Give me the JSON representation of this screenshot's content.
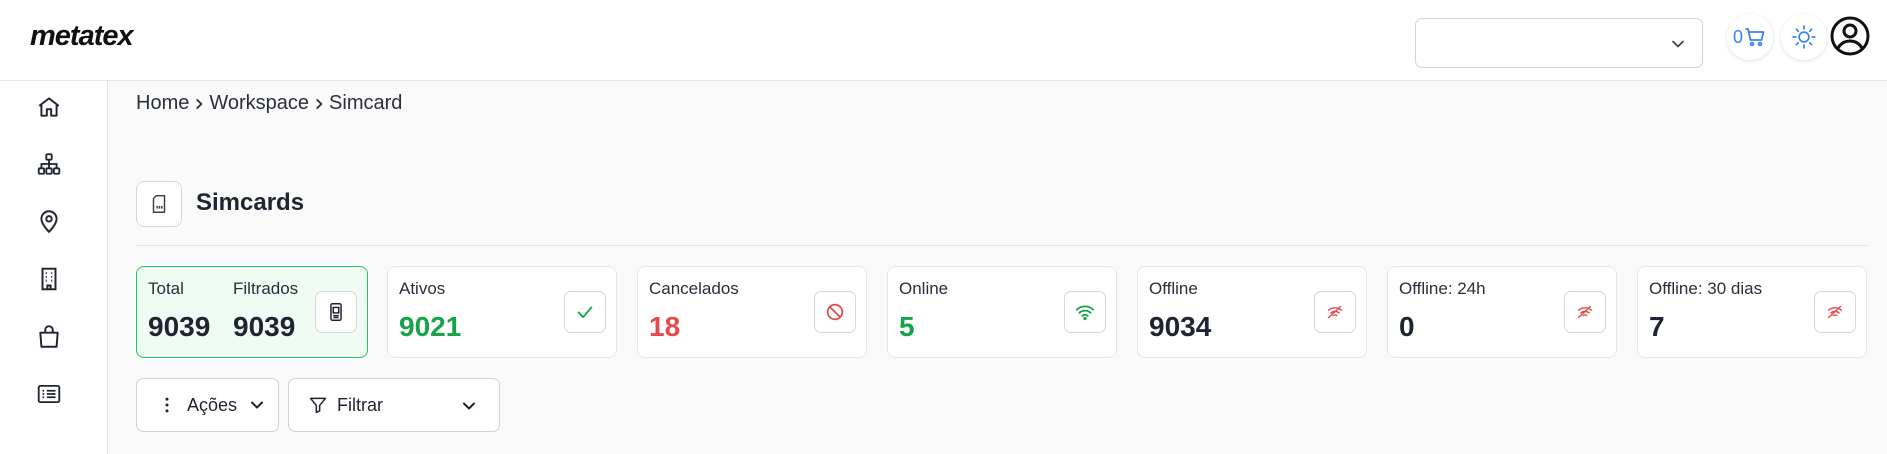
{
  "app": {
    "logo": "metatex"
  },
  "header": {
    "workspace_select_value": "",
    "cart_count": "0",
    "icons": [
      "chevron-down-icon",
      "cart-icon",
      "sun-icon",
      "user-circle-icon"
    ]
  },
  "sidebar": {
    "items": [
      {
        "icon": "home-icon"
      },
      {
        "icon": "sitemap-icon"
      },
      {
        "icon": "location-pin-icon"
      },
      {
        "icon": "building-icon"
      },
      {
        "icon": "briefcase-icon"
      },
      {
        "icon": "list-icon"
      }
    ]
  },
  "breadcrumb": [
    "Home",
    "Workspace",
    "Simcard"
  ],
  "page": {
    "title": "Simcards",
    "icon": "simcard-icon"
  },
  "stats": {
    "total_label": "Total",
    "total_value": "9039",
    "filtered_label": "Filtrados",
    "filtered_value": "9039",
    "cards": [
      {
        "label": "Ativos",
        "value": "9021",
        "color": "#16a34a",
        "icon": "check-icon"
      },
      {
        "label": "Cancelados",
        "value": "18",
        "color": "#e5484d",
        "icon": "ban-icon"
      },
      {
        "label": "Online",
        "value": "5",
        "color": "#16a34a",
        "icon": "wifi-icon"
      },
      {
        "label": "Offline",
        "value": "9034",
        "color": "#1f2433",
        "icon": "wifi-off-icon"
      },
      {
        "label": "Offline: 24h",
        "value": "0",
        "color": "#1f2433",
        "icon": "wifi-off-icon"
      },
      {
        "label": "Offline: 30 dias",
        "value": "7",
        "color": "#1f2433",
        "icon": "wifi-off-icon"
      }
    ]
  },
  "toolbar": {
    "actions_label": "Ações",
    "filter_label": "Filtrar"
  },
  "colors": {
    "accent_green": "#22c55e",
    "danger_red": "#e5484d",
    "link_blue": "#3b82f6"
  }
}
